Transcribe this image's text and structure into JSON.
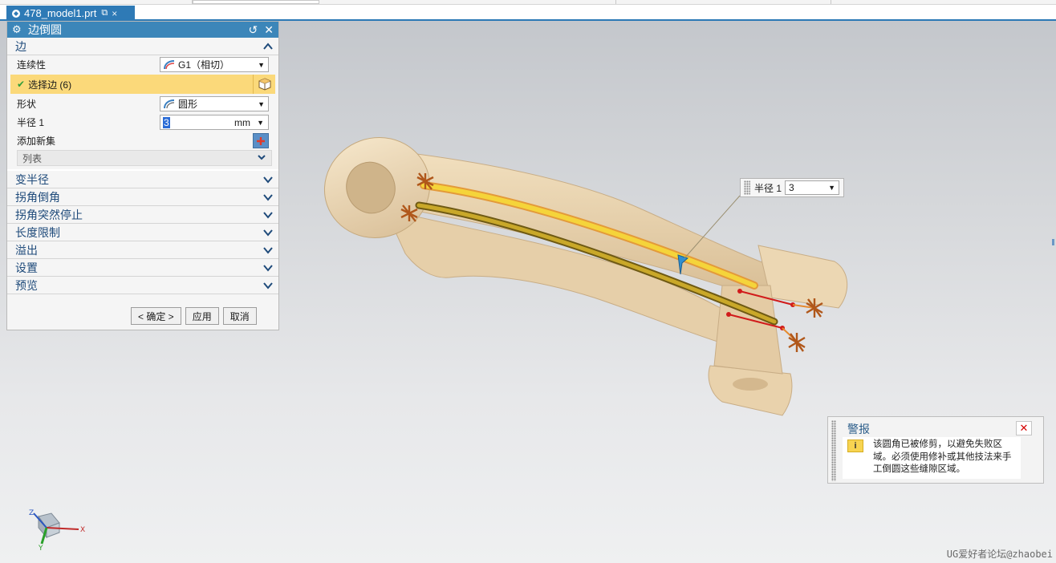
{
  "tab": {
    "title": "478_model1.prt",
    "close": "×"
  },
  "dialog": {
    "title": "边倒圆",
    "edge_section": {
      "title": "边"
    },
    "continuity": {
      "label": "连续性",
      "value": "G1（相切）"
    },
    "select_edges": {
      "label": "选择边 (6)"
    },
    "shape": {
      "label": "形状",
      "value": "圆形"
    },
    "radius": {
      "label": "半径 1",
      "value": "3",
      "unit": "mm"
    },
    "add_new_set": {
      "label": "添加新集"
    },
    "list": {
      "label": "列表"
    },
    "collapsed_sections": [
      "变半径",
      "拐角倒角",
      "拐角突然停止",
      "长度限制",
      "溢出",
      "设置",
      "预览"
    ],
    "buttons": {
      "ok": "< 确定 >",
      "apply": "应用",
      "cancel": "取消"
    }
  },
  "float_label": {
    "label": "半径 1",
    "value": "3"
  },
  "alert": {
    "title": "警报",
    "message": "该圆角已被修剪，以避免失败区域。必须使用修补或其他技法来手工倒圆这些缝隙区域。"
  },
  "triad": {
    "z": "Z",
    "x": "X",
    "y": "Y"
  },
  "watermark": "UG爱好者论坛@zhaobei",
  "colors": {
    "title_bar": "#3c86b9",
    "selection": "#fbd97a",
    "part": "#efdcbc",
    "highlight": "#f5d43a"
  }
}
